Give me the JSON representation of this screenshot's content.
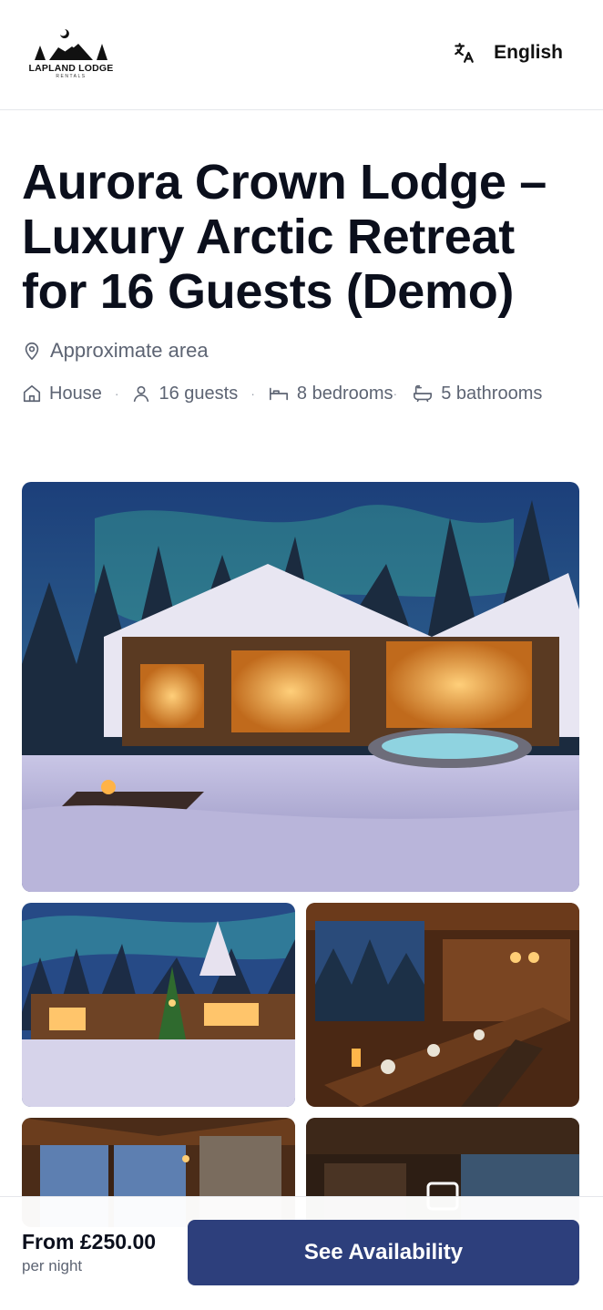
{
  "header": {
    "logo_text": "LAPLAND LODGE",
    "logo_sub": "RENTALS",
    "language_icon": "translate-icon",
    "language_label": "English"
  },
  "listing": {
    "title": "Aurora Crown Lodge – Luxury Arctic Retreat for 16 Guests (Demo)",
    "location": "Approximate area",
    "location_icon": "map-pin-icon",
    "meta": {
      "type": "House",
      "guests": "16 guests",
      "bedrooms": "8 bedrooms",
      "bathrooms": "5 bathrooms",
      "separator": "·"
    },
    "meta_icons": [
      "home-icon",
      "user-icon",
      "bed-icon",
      "bath-icon"
    ]
  },
  "gallery": {
    "photos": [
      "lodge-exterior-aurora",
      "christmas-village",
      "dining-hall",
      "living-room",
      "lounge"
    ]
  },
  "footer": {
    "price": "From £250.00",
    "price_unit": "per night",
    "cta_label": "See Availability"
  },
  "colors": {
    "primary": "#2d3f7c",
    "text": "#0b0f1c",
    "muted": "#5d6473",
    "border": "#e5e7eb"
  }
}
